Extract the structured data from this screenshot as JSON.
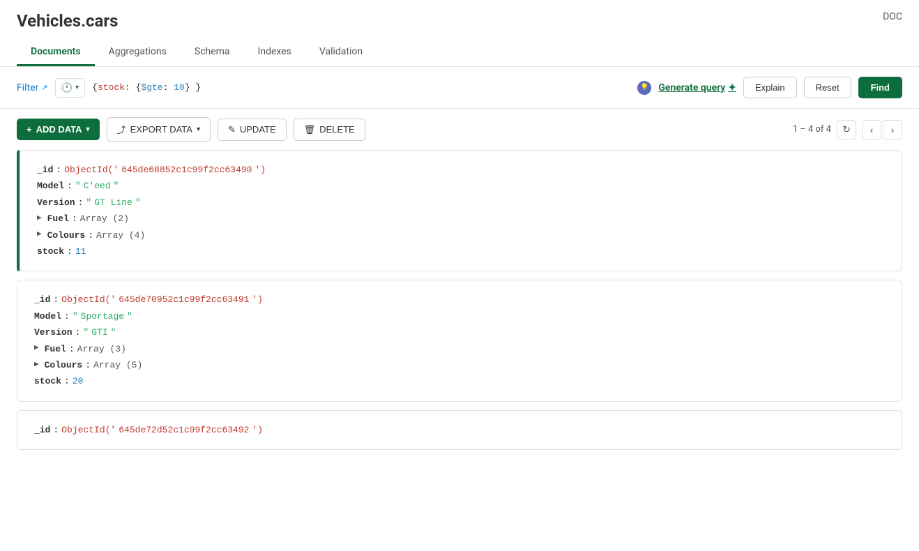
{
  "app": {
    "title_green": "Vehicles",
    "title_dark": ".cars",
    "doc_link": "DOC"
  },
  "tabs": [
    {
      "id": "documents",
      "label": "Documents",
      "active": true
    },
    {
      "id": "aggregations",
      "label": "Aggregations",
      "active": false
    },
    {
      "id": "schema",
      "label": "Schema",
      "active": false
    },
    {
      "id": "indexes",
      "label": "Indexes",
      "active": false
    },
    {
      "id": "validation",
      "label": "Validation",
      "active": false
    }
  ],
  "toolbar": {
    "filter_label": "Filter",
    "query_text": "{stock: {$gte: 10} }",
    "generate_query_label": "Generate query",
    "explain_label": "Explain",
    "reset_label": "Reset",
    "find_label": "Find"
  },
  "action_bar": {
    "add_data_label": "ADD DATA",
    "export_data_label": "EXPORT DATA",
    "update_label": "UPDATE",
    "delete_label": "DELETE",
    "pagination": "1 – 4 of 4"
  },
  "documents": [
    {
      "id": "645de68852c1c99f2cc63490",
      "model": "C'eed",
      "version": "GT Line",
      "fuel_array": "Array (2)",
      "colours_array": "Array (4)",
      "stock": "11"
    },
    {
      "id": "645de70952c1c99f2cc63491",
      "model": "Sportage",
      "version": "GTI",
      "fuel_array": "Array (3)",
      "colours_array": "Array (5)",
      "stock": "20"
    },
    {
      "id": "645de72d52c1c99f2cc63492",
      "model": "",
      "version": "",
      "fuel_array": "",
      "colours_array": "",
      "stock": ""
    }
  ],
  "icons": {
    "expand": "▶",
    "dropdown": "▾",
    "external": "↗",
    "refresh": "↻",
    "prev": "‹",
    "next": "›",
    "plus": "+",
    "export": "⤴",
    "pencil": "✎",
    "trash": "🗑",
    "ai": "✦",
    "spark": "✦"
  }
}
